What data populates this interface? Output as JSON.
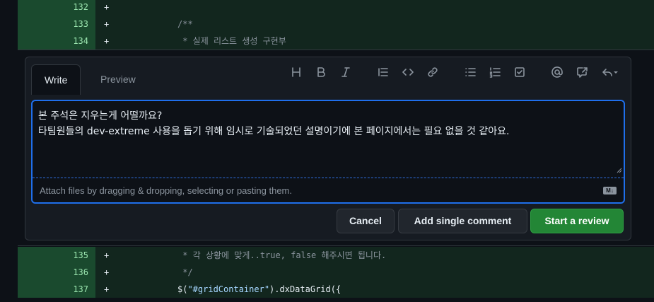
{
  "diff_top": [
    {
      "num": "132",
      "sign": "+",
      "code": ""
    },
    {
      "num": "133",
      "sign": "+",
      "code": "/**"
    },
    {
      "num": "134",
      "sign": "+",
      "code": " * 실제 리스트 생성 구현부"
    }
  ],
  "diff_bottom": [
    {
      "num": "135",
      "sign": "+",
      "code": " * 각 상황에 맞게..true, false 해주시면 됩니다."
    },
    {
      "num": "136",
      "sign": "+",
      "code": " */"
    },
    {
      "num": "137",
      "sign": "+",
      "code_prefix": "$(",
      "code_string": "\"#gridContainer\"",
      "code_suffix": ").dxDataGrid({"
    }
  ],
  "comment_form": {
    "tabs": {
      "write": "Write",
      "preview": "Preview"
    },
    "toolbar": [
      "heading-icon",
      "bold-icon",
      "italic-icon",
      "quote-icon",
      "code-icon",
      "link-icon",
      "unordered-list-icon",
      "ordered-list-icon",
      "task-list-icon",
      "mention-icon",
      "cross-reference-icon",
      "reply-icon"
    ],
    "editor_value": "본 주석은 지우는게 어떨까요?\n타팀원들의 dev-extreme 사용을 돕기 위해 임시로 기술되었던 설명이기에 본 페이지에서는 필요 없을 것 같아요.",
    "attach_hint": "Attach files by dragging & dropping, selecting or pasting them.",
    "markdown_badge": "M↓",
    "buttons": {
      "cancel": "Cancel",
      "single": "Add single comment",
      "review": "Start a review"
    }
  },
  "colors": {
    "accent": "#1f6feb",
    "primary_button": "#238636",
    "added_line_bg": "#12261e"
  }
}
